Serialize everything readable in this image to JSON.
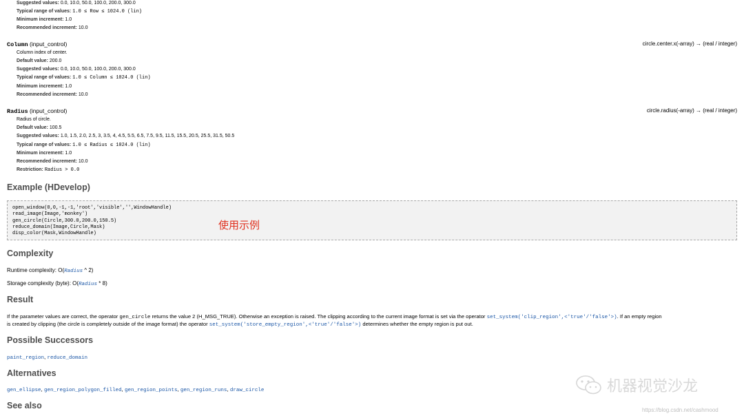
{
  "row_param_tail": {
    "suggested_label": "Suggested values:",
    "suggested": "0.0, 10.0, 50.0, 100.0, 200.0, 300.0",
    "range_label": "Typical range of values:",
    "range": "1.0 ≤ Row ≤ 1024.0 (lin)",
    "min_inc_label": "Minimum increment:",
    "min_inc": "1.0",
    "rec_inc_label": "Recommended increment:",
    "rec_inc": "10.0"
  },
  "column_param": {
    "name": "Column",
    "kind": "(input_control)",
    "semantic_a": "circle.center.x(-array) → (real",
    "semantic_slash": " / ",
    "semantic_b": "integer)",
    "description": "Column index of center.",
    "default_label": "Default value:",
    "default": "200.0",
    "suggested_label": "Suggested values:",
    "suggested": "0.0, 10.0, 50.0, 100.0, 200.0, 300.0",
    "range_label": "Typical range of values:",
    "range": "1.0 ≤ Column ≤ 1024.0 (lin)",
    "min_inc_label": "Minimum increment:",
    "min_inc": "1.0",
    "rec_inc_label": "Recommended increment:",
    "rec_inc": "10.0"
  },
  "radius_param": {
    "name": "Radius",
    "kind": "(input_control)",
    "semantic_a": "circle.radius(-array) → (real",
    "semantic_slash": " / ",
    "semantic_b": "integer)",
    "description": "Radius of circle.",
    "default_label": "Default value:",
    "default": "100.5",
    "suggested_label": "Suggested values:",
    "suggested": "1.0, 1.5, 2.0, 2.5, 3, 3.5, 4, 4.5, 5.5, 6.5, 7.5, 9.5, 11.5, 15.5, 20.5, 25.5, 31.5, 50.5",
    "range_label": "Typical range of values:",
    "range": "1.0 ≤ Radius ≤ 1024.0 (lin)",
    "min_inc_label": "Minimum increment:",
    "min_inc": "1.0",
    "rec_inc_label": "Recommended increment:",
    "rec_inc": "10.0",
    "restriction_label": "Restriction:",
    "restriction": "Radius > 0.0"
  },
  "example": {
    "heading": "Example (HDevelop)",
    "code": "open_window(0,0,-1,-1,'root','visible','',WindowHandle)\nread_image(Image,'monkey')\ngen_circle(Circle,300.0,200.0,150.5)\nreduce_domain(Image,Circle,Mask)\ndisp_color(Mask,WindowHandle)",
    "annotation": "使用示例"
  },
  "complexity": {
    "heading": "Complexity",
    "runtime_prefix": "Runtime complexity: O(",
    "runtime_var": "Radius",
    "runtime_suffix": " ^ 2)",
    "storage_prefix": "Storage complexity (byte): O(",
    "storage_var": "Radius",
    "storage_suffix": " * 8)"
  },
  "result": {
    "heading": "Result",
    "line1_a": "If the parameter values are correct, the operator ",
    "line1_op": "gen_circle",
    "line1_b": " returns the value 2 (H_MSG_TRUE). Otherwise an exception is raised. The clipping according to the current image format is set via the operator ",
    "line1_link": "set_system('clip_region',<'true'/'false'>)",
    "line1_c": ". If an empty region",
    "line2_a": "is created by clipping (the circle is completely outside of the image format) the operator ",
    "line2_link": "set_system('store_empty_region',<'true'/'false'>)",
    "line2_b": " determines whether the empty region is put out."
  },
  "successors": {
    "heading": "Possible Successors",
    "links": [
      "paint_region",
      "reduce_domain"
    ]
  },
  "alternatives": {
    "heading": "Alternatives",
    "links": [
      "gen_ellipse",
      "gen_region_polygon_filled",
      "gen_region_points",
      "gen_region_runs",
      "draw_circle"
    ]
  },
  "see_also": {
    "heading": "See also"
  },
  "watermark": {
    "text": "机器视觉沙龙",
    "url": "https://blog.csdn.net/cashmood",
    "icon": "wechat-icon"
  }
}
